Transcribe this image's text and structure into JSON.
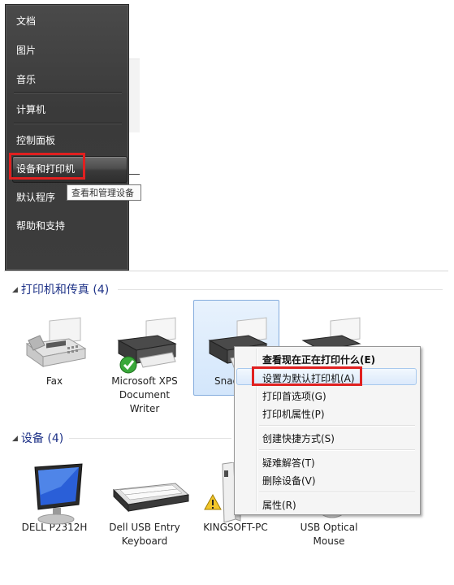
{
  "start_menu": {
    "items": [
      {
        "label": "文档"
      },
      {
        "label": "图片"
      },
      {
        "label": "音乐"
      },
      {
        "label": "计算机"
      },
      {
        "label": "控制面板"
      },
      {
        "label": "设备和打印机"
      },
      {
        "label": "默认程序"
      },
      {
        "label": "帮助和支持"
      }
    ],
    "tooltip": "查看和管理设备"
  },
  "devices_window": {
    "printers_group": {
      "header": "打印机和传真 (4)"
    },
    "devices_group": {
      "header": "设备 (4)"
    },
    "printers": [
      {
        "label": "Fax"
      },
      {
        "label": "Microsoft XPS\nDocument\nWriter",
        "default": true
      },
      {
        "label": "Snag",
        "selected": true
      },
      {
        "label": ""
      }
    ],
    "devices": [
      {
        "label": "DELL P2312H"
      },
      {
        "label": "Dell USB Entry\nKeyboard"
      },
      {
        "label": "KINGSOFT-PC",
        "warning": true
      },
      {
        "label": "USB Optical\nMouse"
      }
    ]
  },
  "context_menu": {
    "items": [
      {
        "label": "查看现在正在打印什么(E)",
        "bold": true
      },
      {
        "label": "设置为默认打印机(A)",
        "highlighted": true
      },
      {
        "label": "打印首选项(G)"
      },
      {
        "label": "打印机属性(P)"
      },
      {
        "label": "创建快捷方式(S)"
      },
      {
        "label": "疑难解答(T)"
      },
      {
        "label": "删除设备(V)"
      },
      {
        "label": "属性(R)"
      }
    ]
  },
  "colors": {
    "annotation_red": "#e02020",
    "group_header": "#1e3287",
    "selection": "#d3e6fb"
  }
}
